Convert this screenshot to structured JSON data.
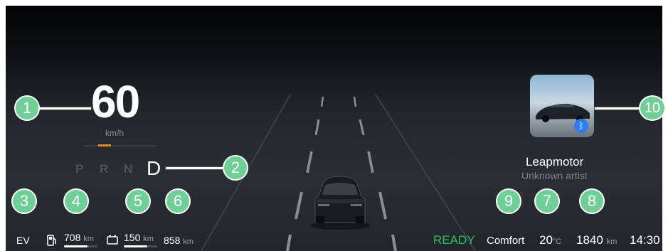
{
  "speed": {
    "value": "60",
    "unit": "km/h"
  },
  "gear": {
    "p": "P",
    "r": "R",
    "n": "N",
    "d": "D",
    "selected": "D"
  },
  "status_bar": {
    "mode": "EV",
    "fuel_range": {
      "value": "708",
      "unit": "km",
      "level": 0.7
    },
    "battery_range": {
      "value": "150",
      "unit": "km",
      "level": 0.7
    },
    "total_range": {
      "value": "858",
      "unit": "km"
    },
    "ready": "READY",
    "drive_mode": "Comfort",
    "temperature": {
      "value": "20",
      "unit": "°C"
    },
    "odometer": {
      "value": "1840",
      "unit": "km"
    },
    "time": "14:30"
  },
  "media": {
    "title": "Leapmotor",
    "artist": "Unknown artist"
  },
  "callouts": [
    "1",
    "2",
    "3",
    "4",
    "5",
    "6",
    "7",
    "8",
    "9",
    "10"
  ],
  "colors": {
    "callout": "#6fcf97",
    "ready": "#2fbf5a",
    "gear_indicator": "#e08a2a"
  }
}
